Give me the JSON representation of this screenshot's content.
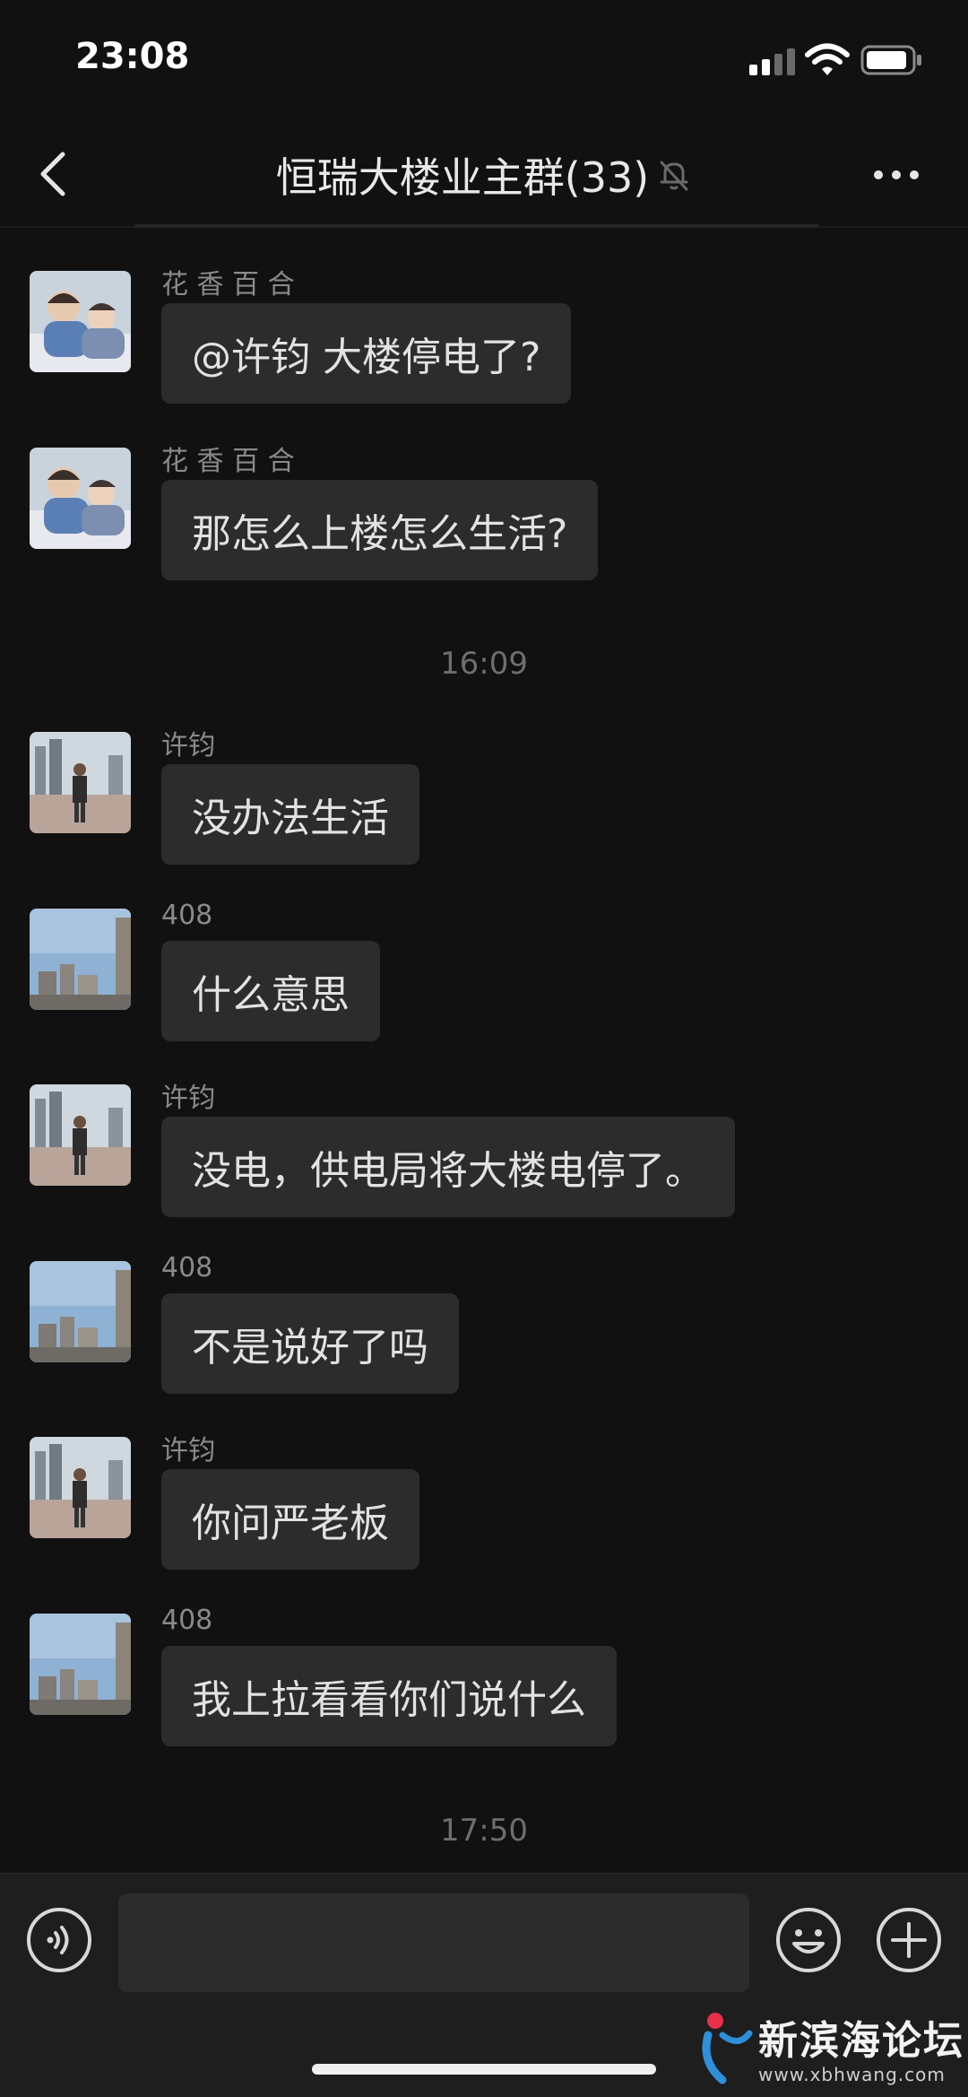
{
  "status_bar": {
    "time": "23:08"
  },
  "nav": {
    "title": "恒瑞大楼业主群(33)"
  },
  "messages": [
    {
      "sender": "花 香 百 合",
      "text": "@许钧 大楼停电了?"
    },
    {
      "sender": "花 香 百 合",
      "text": "那怎么上楼怎么生活?"
    },
    {
      "sender": "许钧",
      "text": "没办法生活"
    },
    {
      "sender": "408",
      "text": "什么意思"
    },
    {
      "sender": "许钧",
      "text": "没电，供电局将大楼电停了。"
    },
    {
      "sender": "408",
      "text": "不是说好了吗"
    },
    {
      "sender": "许钧",
      "text": "你问严老板"
    },
    {
      "sender": "408",
      "text": "我上拉看看你们说什么"
    }
  ],
  "timestamps": [
    "16:09",
    "17:50"
  ],
  "input_bar": {
    "text_value": ""
  },
  "watermark": {
    "name": "新滨海论坛",
    "url": "www.xbhwang.com"
  },
  "icons": {
    "back": "chevron-left-icon",
    "mute": "bell-slash-icon",
    "more": "more-dots-icon",
    "voice": "voice-icon",
    "emoji": "emoji-icon",
    "plus": "plus-icon"
  },
  "colors": {
    "background": "#111111",
    "bubble": "#2c2c2c",
    "text": "#e2e2e2",
    "sender": "#8a8a8a",
    "input_bar": "#1e1e1e"
  }
}
